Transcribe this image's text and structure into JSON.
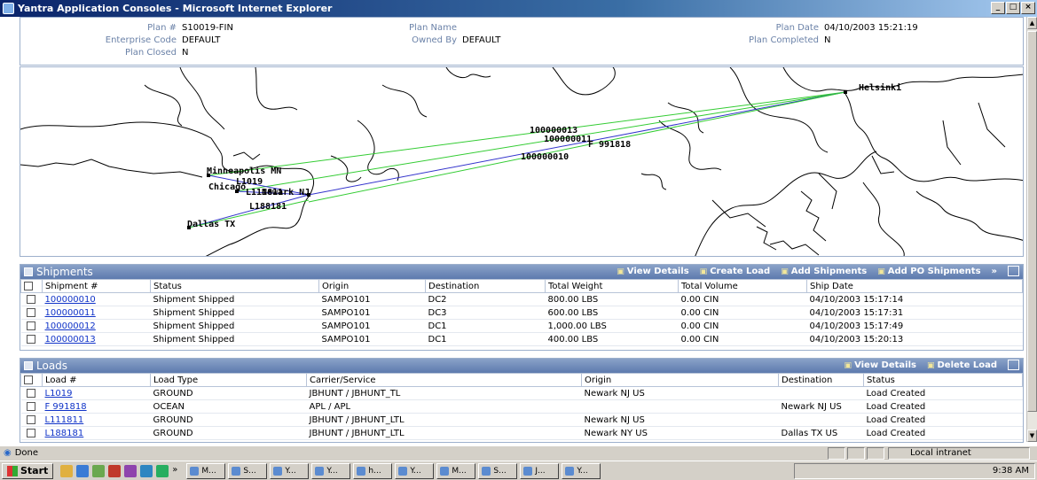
{
  "window": {
    "title": "Yantra Application Consoles - Microsoft Internet Explorer",
    "buttons": [
      "_",
      "□",
      "×"
    ]
  },
  "plan": {
    "plan_no_label": "Plan #",
    "plan_no": "S10019-FIN",
    "plan_name_label": "Plan Name",
    "plan_name": "",
    "plan_date_label": "Plan Date",
    "plan_date": "04/10/2003 15:21:19",
    "enterprise_label": "Enterprise Code",
    "enterprise": "DEFAULT",
    "owned_by_label": "Owned By",
    "owned_by": "DEFAULT",
    "completed_label": "Plan Completed",
    "completed": "N",
    "closed_label": "Plan Closed",
    "closed": "N"
  },
  "map": {
    "labels": {
      "helsinki": "Helsinki",
      "minneapolis": "Minneapolis MN",
      "chicago": "Chicago",
      "newark": "Newark NJ",
      "dallas": "Dallas TX",
      "s13": "100000013",
      "s11": "100000011",
      "s10": "100000010",
      "f991818": "F 991818",
      "l1019": "L1019",
      "l111811": "L111811",
      "l188181": "L188181"
    },
    "colors": {
      "shipment_route": "#33cc33",
      "load_route": "#3333cc",
      "land": "#000000"
    }
  },
  "shipments": {
    "title": "Shipments",
    "actions": [
      "View Details",
      "Create Load",
      "Add Shipments",
      "Add PO Shipments"
    ],
    "more": "»",
    "columns": [
      "Shipment #",
      "Status",
      "Origin",
      "Destination",
      "Total Weight",
      "Total Volume",
      "Ship Date"
    ],
    "rows": [
      [
        "100000010",
        "Shipment Shipped",
        "SAMPO101",
        "DC2",
        "800.00 LBS",
        "0.00 CIN",
        "04/10/2003 15:17:14"
      ],
      [
        "100000011",
        "Shipment Shipped",
        "SAMPO101",
        "DC3",
        "600.00 LBS",
        "0.00 CIN",
        "04/10/2003 15:17:31"
      ],
      [
        "100000012",
        "Shipment Shipped",
        "SAMPO101",
        "DC1",
        "1,000.00 LBS",
        "0.00 CIN",
        "04/10/2003 15:17:49"
      ],
      [
        "100000013",
        "Shipment Shipped",
        "SAMPO101",
        "DC1",
        "400.00 LBS",
        "0.00 CIN",
        "04/10/2003 15:20:13"
      ]
    ]
  },
  "loads": {
    "title": "Loads",
    "actions": [
      "View Details",
      "Delete Load"
    ],
    "columns": [
      "Load #",
      "Load Type",
      "Carrier/Service",
      "Origin",
      "Destination",
      "Status"
    ],
    "rows": [
      [
        "L1019",
        "GROUND",
        "JBHUNT / JBHUNT_TL",
        "Newark  NJ  US",
        "",
        "Load Created"
      ],
      [
        "F 991818",
        "OCEAN",
        "APL / APL",
        "",
        "Newark  NJ  US",
        "Load Created"
      ],
      [
        "L111811",
        "GROUND",
        "JBHUNT / JBHUNT_LTL",
        "Newark  NJ  US",
        "",
        "Load Created"
      ],
      [
        "L188181",
        "GROUND",
        "JBHUNT / JBHUNT_LTL",
        "Newark  NY  US",
        "Dallas  TX  US",
        "Load Created"
      ]
    ]
  },
  "statusbar": {
    "text": "Done",
    "zone": "Local intranet"
  },
  "taskbar": {
    "start": "Start",
    "chevron": "»",
    "tasks": [
      "M...",
      "S...",
      "Y...",
      "Y...",
      "h...",
      "Y...",
      "M...",
      "S...",
      "J...",
      "Y..."
    ],
    "clock": "9:38 AM"
  }
}
